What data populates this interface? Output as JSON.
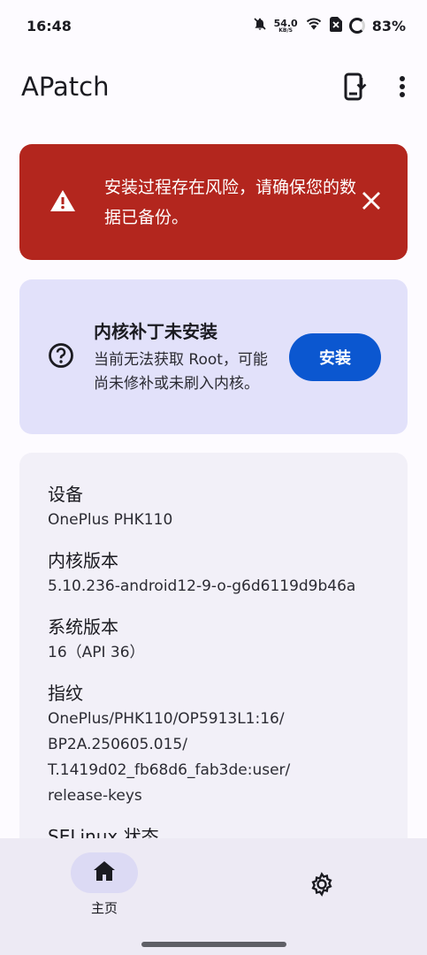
{
  "status_bar": {
    "time": "16:48",
    "net_speed_value": "54.0",
    "net_speed_unit": "KB/S",
    "battery": "83%",
    "icons": [
      "bell-off-icon",
      "wifi-icon",
      "no-sim-icon",
      "battery-ring-icon"
    ]
  },
  "app_bar": {
    "title": "APatch",
    "icons": [
      "install-icon",
      "more-vert-icon"
    ]
  },
  "warning": {
    "text": "安装过程存在风险，请确保您的数据已备份。",
    "icon": "warning-icon",
    "close_icon": "close-icon",
    "color": "#b3261e"
  },
  "kernel": {
    "title": "内核补丁未安装",
    "description": "当前无法获取 Root，可能尚未修补或未刷入内核。",
    "button_label": "安装",
    "icon": "help-circle-icon",
    "button_color": "#0b57d0"
  },
  "info": {
    "items": [
      {
        "label": "设备",
        "value": "OnePlus PHK110"
      },
      {
        "label": "内核版本",
        "value": "5.10.236-android12-9-o-g6d6119d9b46a"
      },
      {
        "label": "系统版本",
        "value": "16（API 36）"
      },
      {
        "label": "指纹",
        "value": "OnePlus/PHK110/OP5913L1:16/\nBP2A.250605.015/\nT.1419d02_fb68d6_fab3de:user/\nrelease-keys"
      },
      {
        "label": "SELinux 状态",
        "value": ""
      }
    ]
  },
  "bottom_nav": {
    "home_label": "主页",
    "icons": [
      "home-icon",
      "settings-icon"
    ]
  }
}
